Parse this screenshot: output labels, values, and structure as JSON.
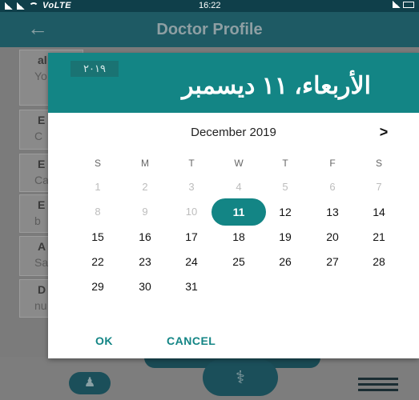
{
  "statusbar": {
    "network_label": "VoLTE",
    "time": "16:22"
  },
  "appbar": {
    "back_icon": "arrow-left-icon",
    "title": "Doctor Profile"
  },
  "background_cards": [
    {
      "label": "al",
      "value": "Yo"
    },
    {
      "label": "E",
      "value": "C"
    },
    {
      "label": "E",
      "value": "Ca"
    },
    {
      "label": "E",
      "value": "b"
    },
    {
      "label": "A",
      "value": "Sa"
    },
    {
      "label": "D",
      "value": "nu"
    }
  ],
  "dialog": {
    "year": "٢٠١٩",
    "selected_date_text": "الأربعاء، ١١ ديسمبر",
    "month_label": "December 2019",
    "next_icon": "chevron-right-icon",
    "weekdays": [
      "S",
      "M",
      "T",
      "W",
      "T",
      "F",
      "S"
    ],
    "weeks": [
      [
        "1",
        "2",
        "3",
        "4",
        "5",
        "6",
        "7"
      ],
      [
        "8",
        "9",
        "10",
        "11",
        "12",
        "13",
        "14"
      ],
      [
        "15",
        "16",
        "17",
        "18",
        "19",
        "20",
        "21"
      ],
      [
        "22",
        "23",
        "24",
        "25",
        "26",
        "27",
        "28"
      ],
      [
        "29",
        "30",
        "31",
        "",
        "",
        "",
        ""
      ]
    ],
    "selected_day": "11",
    "ok_label": "OK",
    "cancel_label": "CANCEL",
    "accent_color": "#138585"
  },
  "bottom_nav": {
    "left_icon": "person-icon",
    "center_icon": "stethoscope-icon",
    "right_icon": "menu-icon"
  }
}
